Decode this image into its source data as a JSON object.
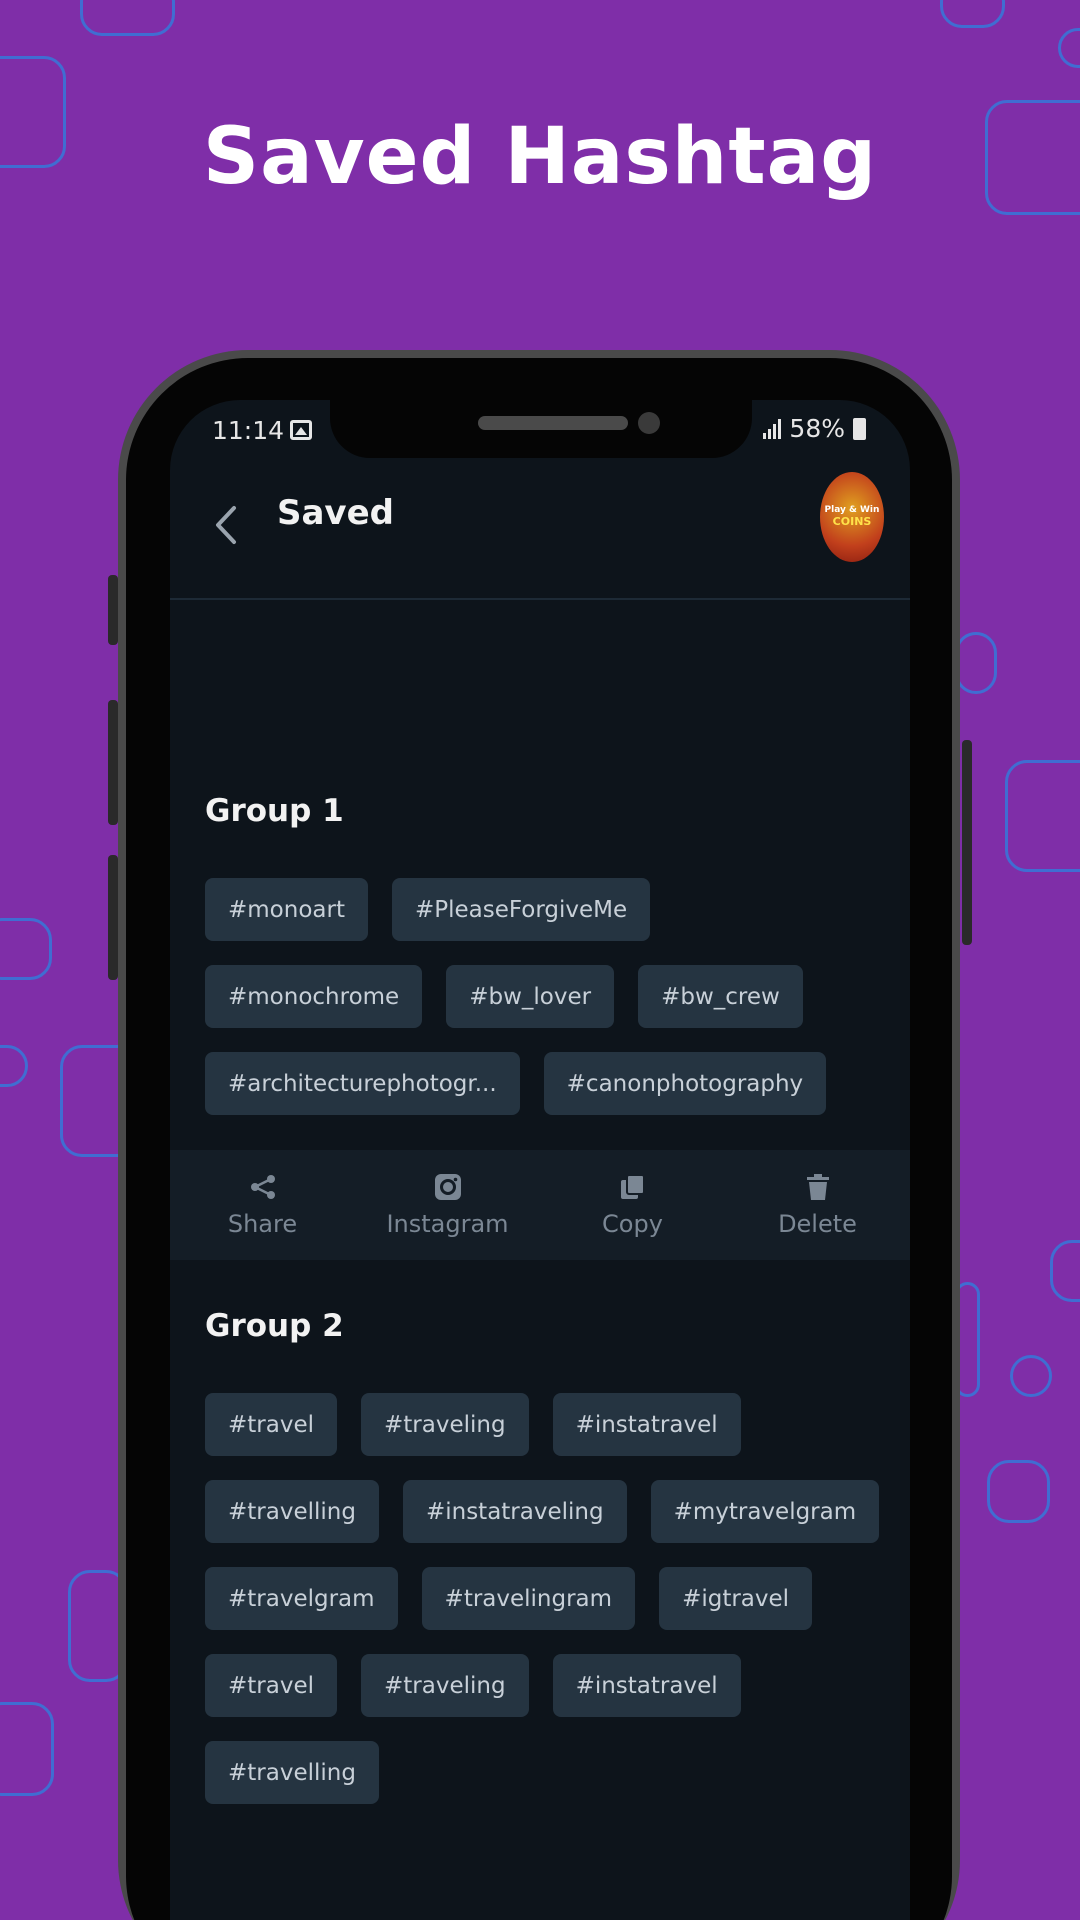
{
  "headline": "Saved Hashtag",
  "colors": {
    "background": "#7f2ea8",
    "screen": "#0d141b",
    "chip": "#253441",
    "deco": "#3a74d6"
  },
  "status_bar": {
    "time": "11:14",
    "battery": "58%"
  },
  "app_bar": {
    "title": "Saved",
    "back_icon": "chevron-left-icon",
    "promo_line1": "Play & Win",
    "promo_line2": "COINS"
  },
  "groups": [
    {
      "title": "Group 1",
      "tags": [
        "#monoart",
        "#PleaseForgiveMe",
        "#monochrome",
        "#bw_lover",
        "#bw_crew",
        "#architecturephotogr...",
        "#canonphotography"
      ]
    },
    {
      "title": "Group 2",
      "tags": [
        "#travel",
        "#traveling",
        "#instatravel",
        "#travelling",
        "#instatraveling",
        "#mytravelgram",
        "#travelgram",
        "#travelingram",
        "#igtravel",
        "#travel",
        "#traveling",
        "#instatravel",
        "#travelling"
      ]
    }
  ],
  "actions": [
    {
      "label": "Share",
      "icon": "share-icon"
    },
    {
      "label": "Instagram",
      "icon": "instagram-icon"
    },
    {
      "label": "Copy",
      "icon": "copy-icon"
    },
    {
      "label": "Delete",
      "icon": "trash-icon"
    }
  ]
}
